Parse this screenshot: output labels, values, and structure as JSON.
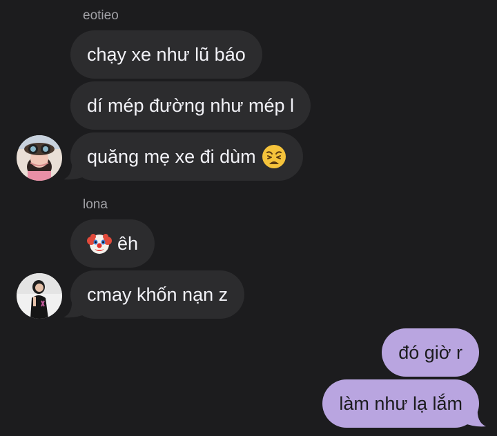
{
  "groups": [
    {
      "sender": "eotieo",
      "messages": [
        {
          "text": "chạy xe như lũ báo"
        },
        {
          "text": "dí mép đường như mép l"
        },
        {
          "text": "quăng mẹ xe đi dùm",
          "emoji": "weary-face-icon"
        }
      ]
    },
    {
      "sender": "lona",
      "messages": [
        {
          "text": "êh",
          "emoji": "clown-face-icon"
        },
        {
          "text": "cmay khốn nạn z"
        }
      ]
    }
  ],
  "outgoing": [
    {
      "text": "đó giờ r"
    },
    {
      "text": "làm như lạ lắm"
    }
  ],
  "colors": {
    "background": "#1c1c1e",
    "incoming_bubble": "#2c2c2e",
    "outgoing_bubble": "#b9a5e0",
    "sender_name": "#a1a1a6"
  }
}
